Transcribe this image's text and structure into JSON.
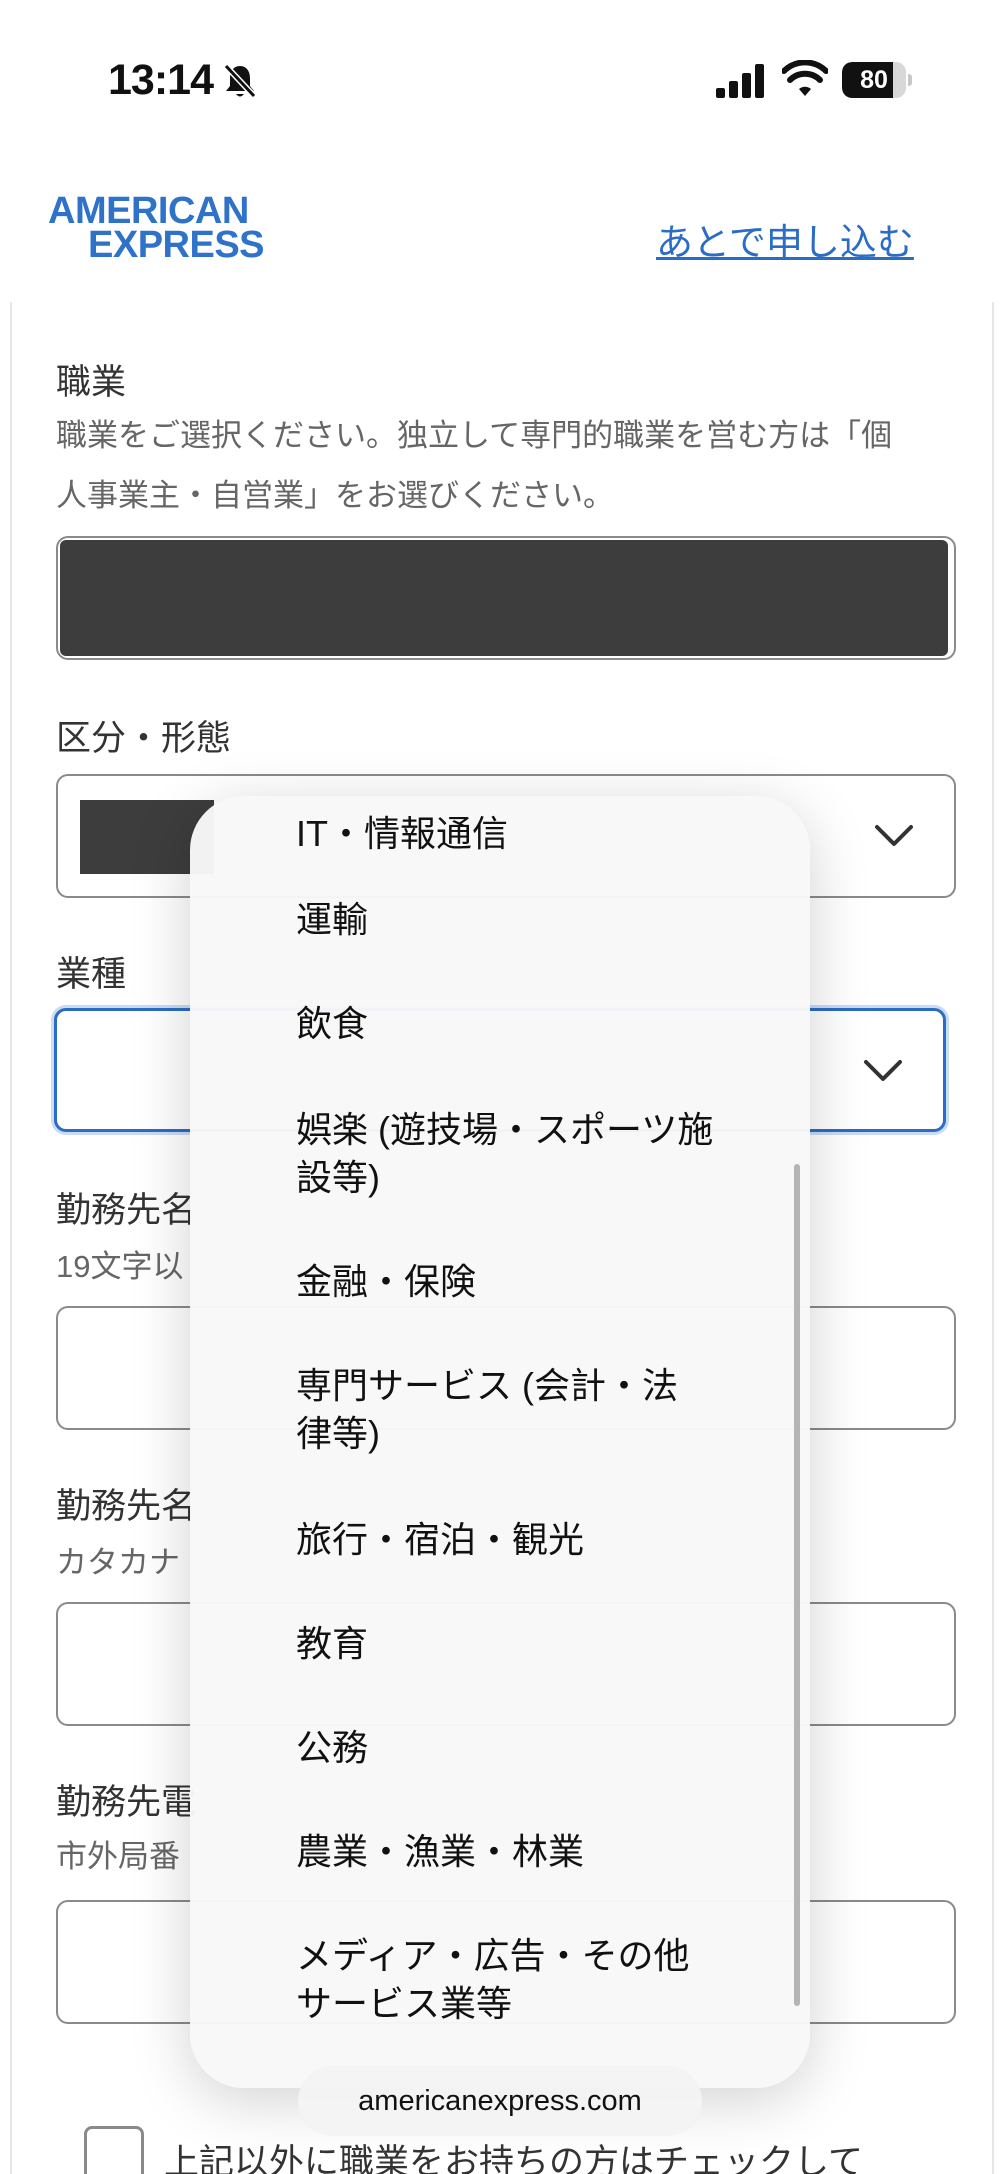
{
  "status_bar": {
    "time": "13:14",
    "battery_percent": "80",
    "battery_level": 0.8,
    "icons": [
      "bell-slash-icon",
      "cellular-signal-icon",
      "wifi-icon",
      "battery-icon"
    ]
  },
  "header": {
    "logo_line1": "AMERICAN",
    "logo_line2": "EXPRESS",
    "apply_later_link": "あとで申し込む",
    "brand_color": "#2e72c9"
  },
  "form": {
    "occupation": {
      "label": "職業",
      "help_line1": "職業をご選択ください。独立して専門的職業を営む方は「個",
      "help_line2": "人事業主・自営業」をお選びください。"
    },
    "category": {
      "label": "区分・形態"
    },
    "industry": {
      "label": "業種"
    },
    "employer_name": {
      "label": "勤務先名",
      "help": "19文字以"
    },
    "employer_name_kana": {
      "label": "勤務先名",
      "help": "カタカナ"
    },
    "employer_phone": {
      "label": "勤務先電",
      "help": "市外局番"
    },
    "other_job_checkbox_label": "上記以外に職業をお持ちの方はチェックして"
  },
  "picker": {
    "options": [
      "IT・情報通信",
      "運輸",
      "飲食",
      "娯楽 (遊技場・スポーツ施設等)",
      "金融・保険",
      "専門サービス (会計・法律等)",
      "旅行・宿泊・観光",
      "教育",
      "公務",
      "農業・漁業・林業",
      "メディア・広告・その他サービス業等"
    ]
  },
  "browser": {
    "url": "americanexpress.com"
  },
  "colors": {
    "accent": "#2b6cc4",
    "redaction": "#3d3d3d"
  }
}
